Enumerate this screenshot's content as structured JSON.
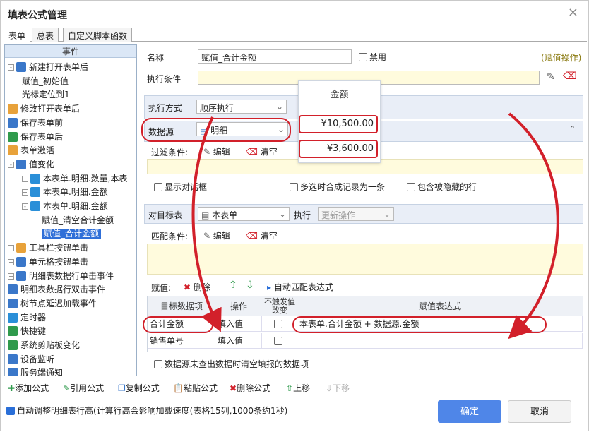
{
  "window": {
    "title": "填表公式管理",
    "close": "×"
  },
  "tabs": [
    "表单",
    "总表",
    "自定义脚本函数"
  ],
  "tree": {
    "header": "事件",
    "items": [
      {
        "label": "新建打开表单后",
        "level": 0,
        "exp": "-",
        "icon": "#3a77c9"
      },
      {
        "label": "赋值_初始值",
        "level": 2
      },
      {
        "label": "光标定位到1",
        "level": 2
      },
      {
        "label": "修改打开表单后",
        "level": 0,
        "icon": "#e8a23a"
      },
      {
        "label": "保存表单前",
        "level": 0,
        "icon": "#3a77c9"
      },
      {
        "label": "保存表单后",
        "level": 0,
        "icon": "#2f9a4c"
      },
      {
        "label": "表单激活",
        "level": 0,
        "icon": "#e8a23a"
      },
      {
        "label": "值变化",
        "level": 0,
        "exp": "-",
        "icon": "#3a77c9"
      },
      {
        "label": "本表单.明细.数量,本表",
        "level": 1,
        "exp": "+",
        "icon": "#2a8fd8"
      },
      {
        "label": "本表单.明细.金额",
        "level": 1,
        "exp": "+",
        "icon": "#2a8fd8"
      },
      {
        "label": "本表单.明细.金额",
        "level": 1,
        "exp": "-",
        "icon": "#2a8fd8"
      },
      {
        "label": "赋值_清空合计金额",
        "level": 3
      },
      {
        "label": "赋值_合计金额",
        "level": 3,
        "selected": true
      },
      {
        "label": "工具栏按钮单击",
        "level": 0,
        "exp": "+",
        "icon": "#e8a23a"
      },
      {
        "label": "单元格按钮单击",
        "level": 0,
        "exp": "+",
        "icon": "#3a77c9"
      },
      {
        "label": "明细表数据行单击事件",
        "level": 0,
        "exp": "+",
        "icon": "#3a77c9"
      },
      {
        "label": "明细表数据行双击事件",
        "level": 0,
        "icon": "#3a77c9"
      },
      {
        "label": "树节点延迟加载事件",
        "level": 0,
        "icon": "#3a77c9"
      },
      {
        "label": "定时器",
        "level": 0,
        "icon": "#2a8fd8"
      },
      {
        "label": "快捷键",
        "level": 0,
        "icon": "#2f9a4c"
      },
      {
        "label": "系统剪贴板变化",
        "level": 0,
        "icon": "#2f9a4c"
      },
      {
        "label": "设备监听",
        "level": 0,
        "icon": "#3a77c9"
      },
      {
        "label": "服务端通知",
        "level": 0,
        "icon": "#3a77c9"
      }
    ]
  },
  "form": {
    "name_label": "名称",
    "name_value": "赋值_合计金额",
    "disable_label": "禁用",
    "kind": "(赋值操作)",
    "cond_label": "执行条件",
    "mode_label": "执行方式",
    "mode_value": "顺序执行",
    "src_label": "数据源",
    "src_value": "明细",
    "filter_label": "过滤条件:",
    "edit": "编辑",
    "clear": "清空",
    "show_dialog": "显示对话框",
    "merge": "多选时合成记录为一条",
    "hidden": "包含被隐藏的行",
    "target_label": "对目标表",
    "target_value": "本表单",
    "exec_label": "执行",
    "exec_value": "更新操作",
    "match_label": "匹配条件:",
    "assign_label": "赋值:",
    "delete": "删除",
    "auto_match": "自动匹配表达式",
    "grid_headers": [
      "目标数据项",
      "操作",
      "不触发值改变",
      "赋值表达式"
    ],
    "rows": [
      {
        "item": "合计金额",
        "op": "填入值",
        "expr": "本表单.合计金额 + 数据源.金额"
      },
      {
        "item": "销售单号",
        "op": "填入值",
        "expr": ""
      }
    ],
    "clear_empty": "数据源未查出数据时清空填报的数据项"
  },
  "popup": {
    "header": "金额",
    "values": [
      "¥10,500.00",
      "¥3,600.00"
    ]
  },
  "toolbar": [
    "添加公式",
    "引用公式",
    "复制公式",
    "粘贴公式",
    "删除公式",
    "上移",
    "下移"
  ],
  "footer": {
    "auto_adjust": "自动调整明细表行高(计算行高会影响加载速度(表格15列,1000条约1秒)",
    "ok": "确定",
    "cancel": "取消"
  }
}
